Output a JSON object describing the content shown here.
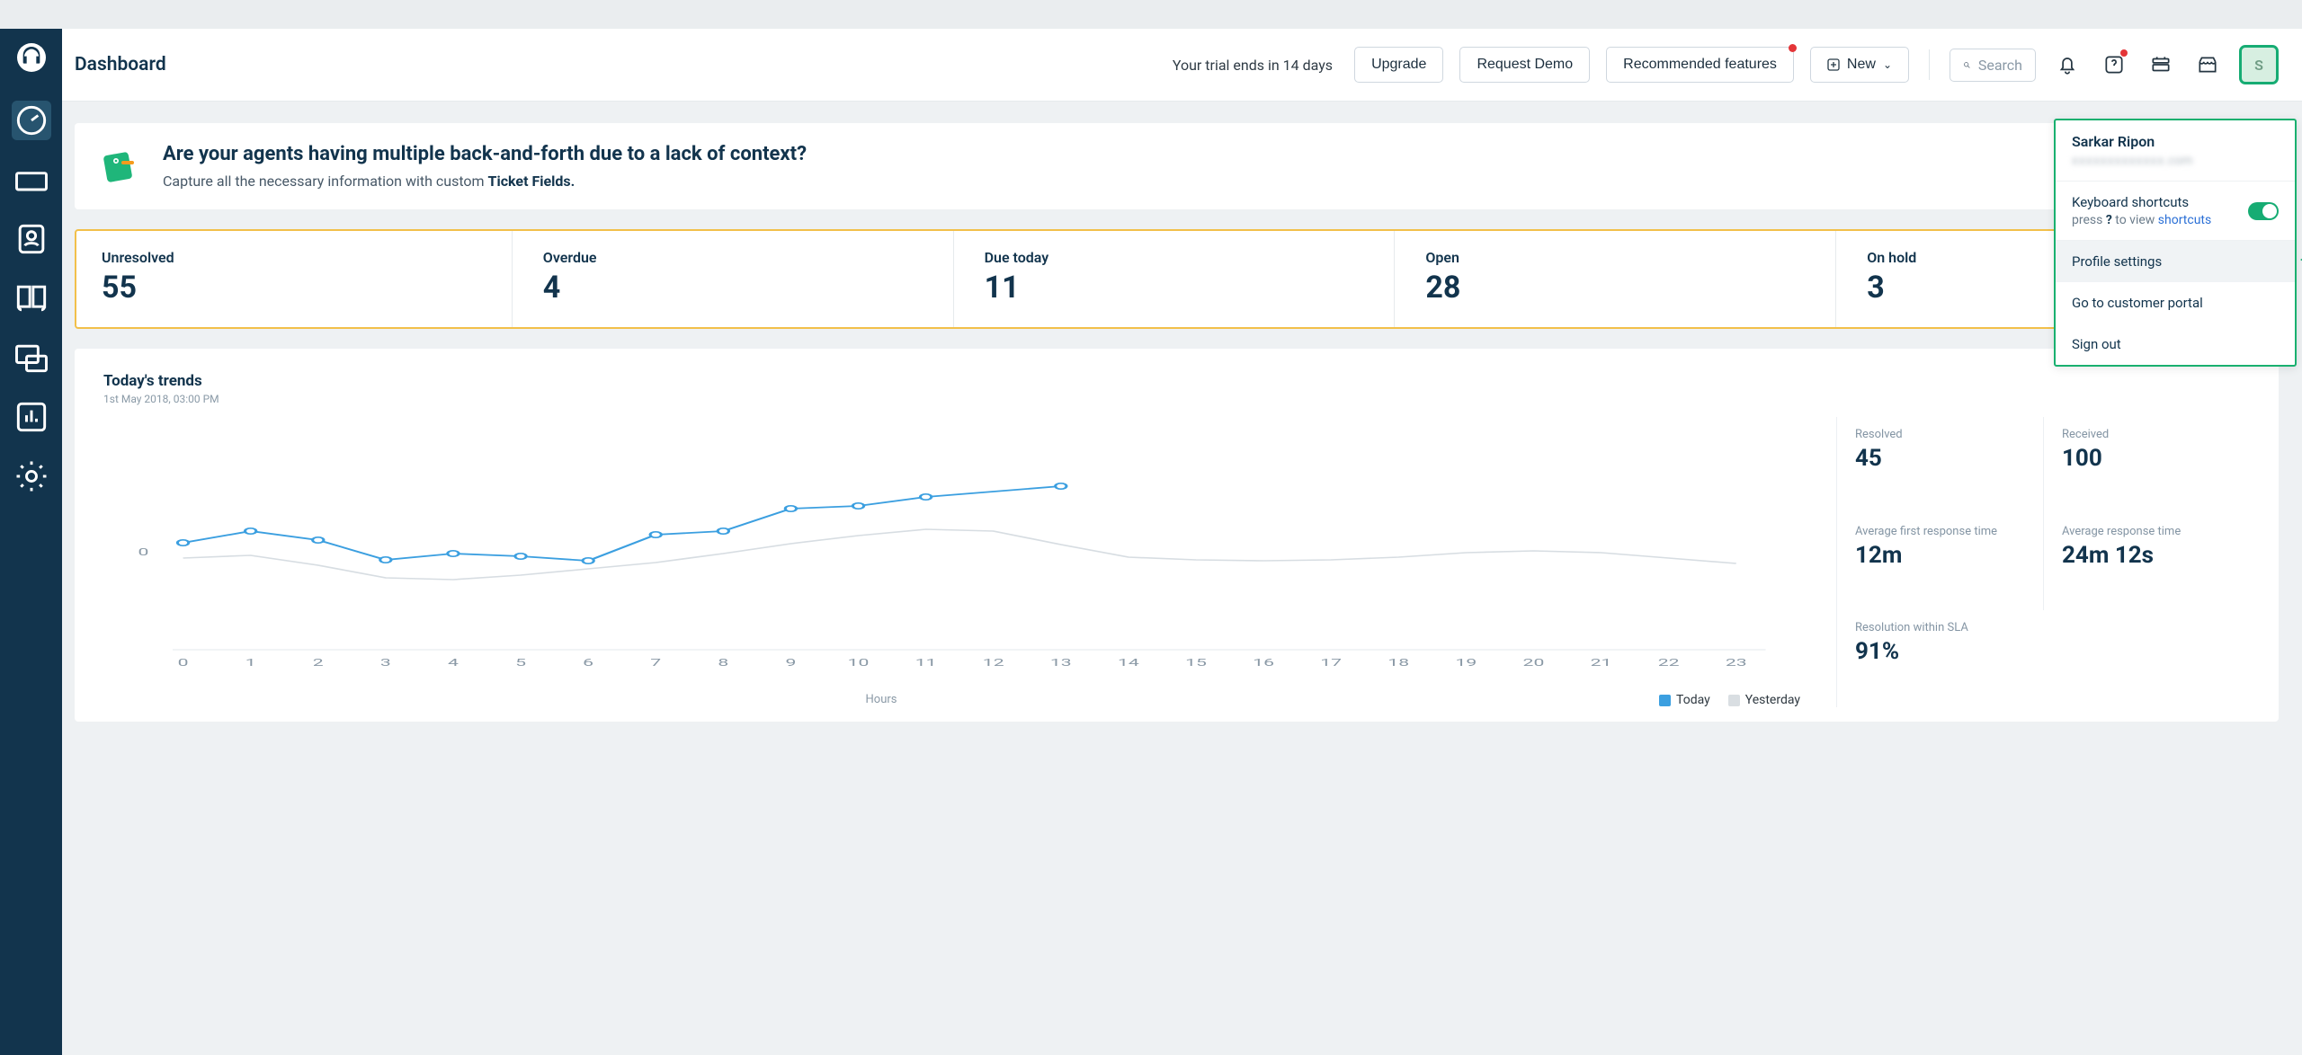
{
  "header": {
    "title": "Dashboard",
    "trial_text": "Your trial ends in 14 days",
    "upgrade": "Upgrade",
    "request_demo": "Request Demo",
    "recommended": "Recommended features",
    "new": "New",
    "search_placeholder": "Search"
  },
  "banner": {
    "title": "Are your agents having multiple back-and-forth due to a lack of context?",
    "subtitle_prefix": "Capture all the necessary information with custom ",
    "subtitle_bold": "Ticket Fields."
  },
  "stats": [
    {
      "label": "Unresolved",
      "value": "55"
    },
    {
      "label": "Overdue",
      "value": "4"
    },
    {
      "label": "Due today",
      "value": "11"
    },
    {
      "label": "Open",
      "value": "28"
    },
    {
      "label": "On hold",
      "value": "3"
    }
  ],
  "trends": {
    "title": "Today's trends",
    "timestamp": "1st May 2018, 03:00 PM",
    "xlabel": "Hours",
    "legend_today": "Today",
    "legend_yesterday": "Yesterday",
    "y_tick": "0",
    "metrics": [
      {
        "label": "Resolved",
        "value": "45"
      },
      {
        "label": "Received",
        "value": "100"
      },
      {
        "label": "Average first response time",
        "value": "12m"
      },
      {
        "label": "Average response time",
        "value": "24m 12s"
      },
      {
        "label": "Resolution within SLA",
        "value": "91%"
      }
    ]
  },
  "chart_data": {
    "type": "line",
    "x": [
      0,
      1,
      2,
      3,
      4,
      5,
      6,
      7,
      8,
      9,
      10,
      11,
      12,
      13,
      14,
      15,
      16,
      17,
      18,
      19,
      20,
      21,
      22,
      23
    ],
    "series": [
      {
        "name": "Today",
        "values": [
          12,
          28,
          16,
          -10,
          -2,
          -6,
          -12,
          22,
          28,
          54,
          58,
          70,
          78
        ]
      },
      {
        "name": "Yesterday",
        "values": [
          -8,
          -4,
          -18,
          -34,
          -36,
          -30,
          -22,
          -14,
          -2,
          12,
          22,
          30,
          28,
          10,
          -6,
          -10,
          -12,
          -10,
          -6,
          -2,
          2,
          -2,
          -8,
          -14
        ]
      }
    ],
    "xlabel": "Hours",
    "ylabel": "",
    "ylim": [
      -40,
      80
    ]
  },
  "profile": {
    "initial": "S",
    "name": "Sarkar Ripon",
    "email_suffix": ".com",
    "kbd_label": "Keyboard shortcuts",
    "kbd_sub_prefix": "press ",
    "kbd_sub_q": "?",
    "kbd_sub_mid": " to view ",
    "kbd_sub_link": "shortcuts",
    "item_profile": "Profile settings",
    "item_portal": "Go to customer portal",
    "item_signout": "Sign out"
  }
}
